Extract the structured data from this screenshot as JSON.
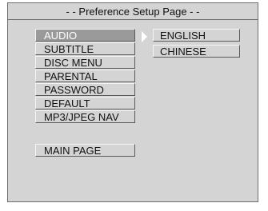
{
  "title": "- - Preference Setup Page - -",
  "menu": {
    "items": [
      {
        "label": "AUDIO"
      },
      {
        "label": "SUBTITLE"
      },
      {
        "label": "DISC MENU"
      },
      {
        "label": "PARENTAL"
      },
      {
        "label": "PASSWORD"
      },
      {
        "label": "DEFAULT"
      },
      {
        "label": "MP3/JPEG NAV"
      }
    ],
    "selected": "AUDIO",
    "main_page_label": "MAIN PAGE"
  },
  "submenu": {
    "items": [
      {
        "label": "ENGLISH"
      },
      {
        "label": "CHINESE"
      }
    ]
  },
  "colors": {
    "panel": "#d4d4d4",
    "selected": "#9a9a9a",
    "border": "#6e6e6e"
  },
  "icons": {
    "submenu_pointer": "triangle-right-icon"
  }
}
